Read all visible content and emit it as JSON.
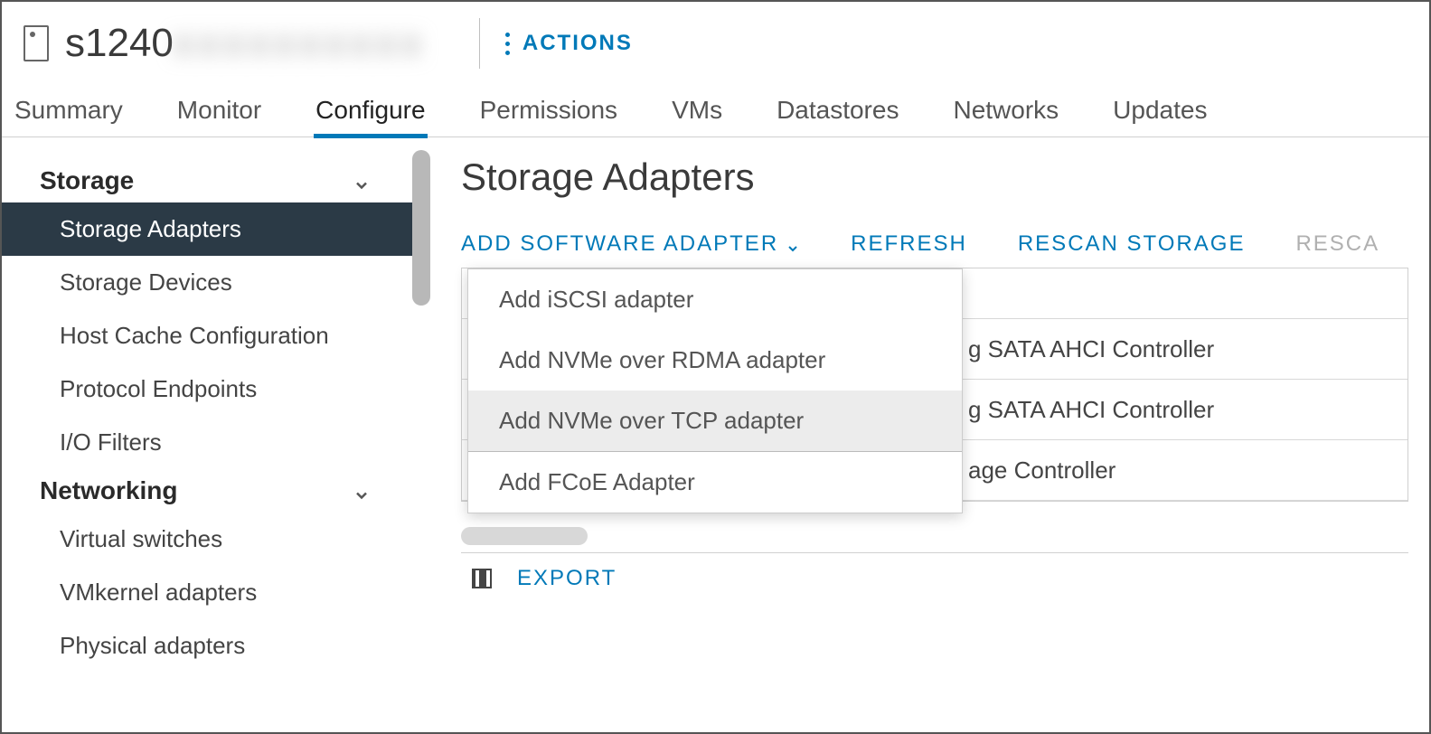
{
  "header": {
    "host_name": "s1240",
    "actions_label": "ACTIONS"
  },
  "tabs": [
    "Summary",
    "Monitor",
    "Configure",
    "Permissions",
    "VMs",
    "Datastores",
    "Networks",
    "Updates"
  ],
  "active_tab_index": 2,
  "sidebar": {
    "sections": [
      {
        "title": "Storage",
        "items": [
          "Storage Adapters",
          "Storage Devices",
          "Host Cache Configuration",
          "Protocol Endpoints",
          "I/O Filters"
        ],
        "selected_index": 0
      },
      {
        "title": "Networking",
        "items": [
          "Virtual switches",
          "VMkernel adapters",
          "Physical adapters"
        ]
      }
    ]
  },
  "main": {
    "title": "Storage Adapters",
    "toolbar": {
      "add_label": "ADD SOFTWARE ADAPTER",
      "refresh_label": "REFRESH",
      "rescan_storage_label": "RESCAN STORAGE",
      "rescan_adapter_label": "RESCA"
    },
    "dropdown": {
      "items": [
        "Add iSCSI adapter",
        "Add NVMe over RDMA adapter",
        "Add NVMe over TCP adapter",
        "Add FCoE Adapter"
      ],
      "hover_index": 2
    },
    "table_rows": [
      "",
      "g SATA AHCI Controller",
      "g SATA AHCI Controller",
      "age Controller"
    ],
    "export_label": "EXPORT"
  }
}
